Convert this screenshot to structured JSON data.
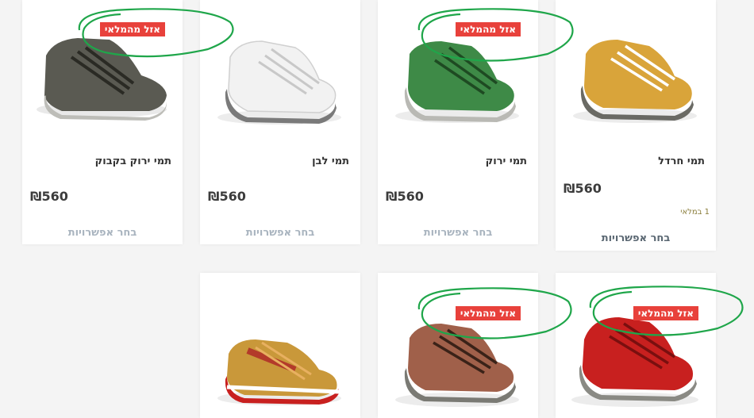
{
  "products": [
    {
      "name": "תמי ירוק בקבוק",
      "price": "₪560",
      "badge": "אזל מהמלאי",
      "options": "בחר אפשרויות",
      "color": "#5a5a52"
    },
    {
      "name": "תמי לבן",
      "price": "₪560",
      "options": "בחר אפשרויות",
      "color": "#f2f2f2"
    },
    {
      "name": "תמי ירוק",
      "price": "₪560",
      "badge": "אזל מהמלאי",
      "options": "בחר אפשרויות",
      "color": "#3e8a47"
    },
    {
      "name": "תמי חרדל",
      "price": "₪560",
      "stock": "1 במלאי",
      "options": "בחר אפשרויות",
      "color": "#d9a43a"
    },
    {
      "name": "",
      "color": "#c9983a"
    },
    {
      "badge": "אזל מהמלאי",
      "color": "#a0604a"
    },
    {
      "badge": "אזל מהמלאי",
      "color": "#c8201f"
    }
  ],
  "colors": {
    "badge": "#e8413b",
    "circle": "#1fa64a",
    "page_bg": "#f4f4f4"
  }
}
